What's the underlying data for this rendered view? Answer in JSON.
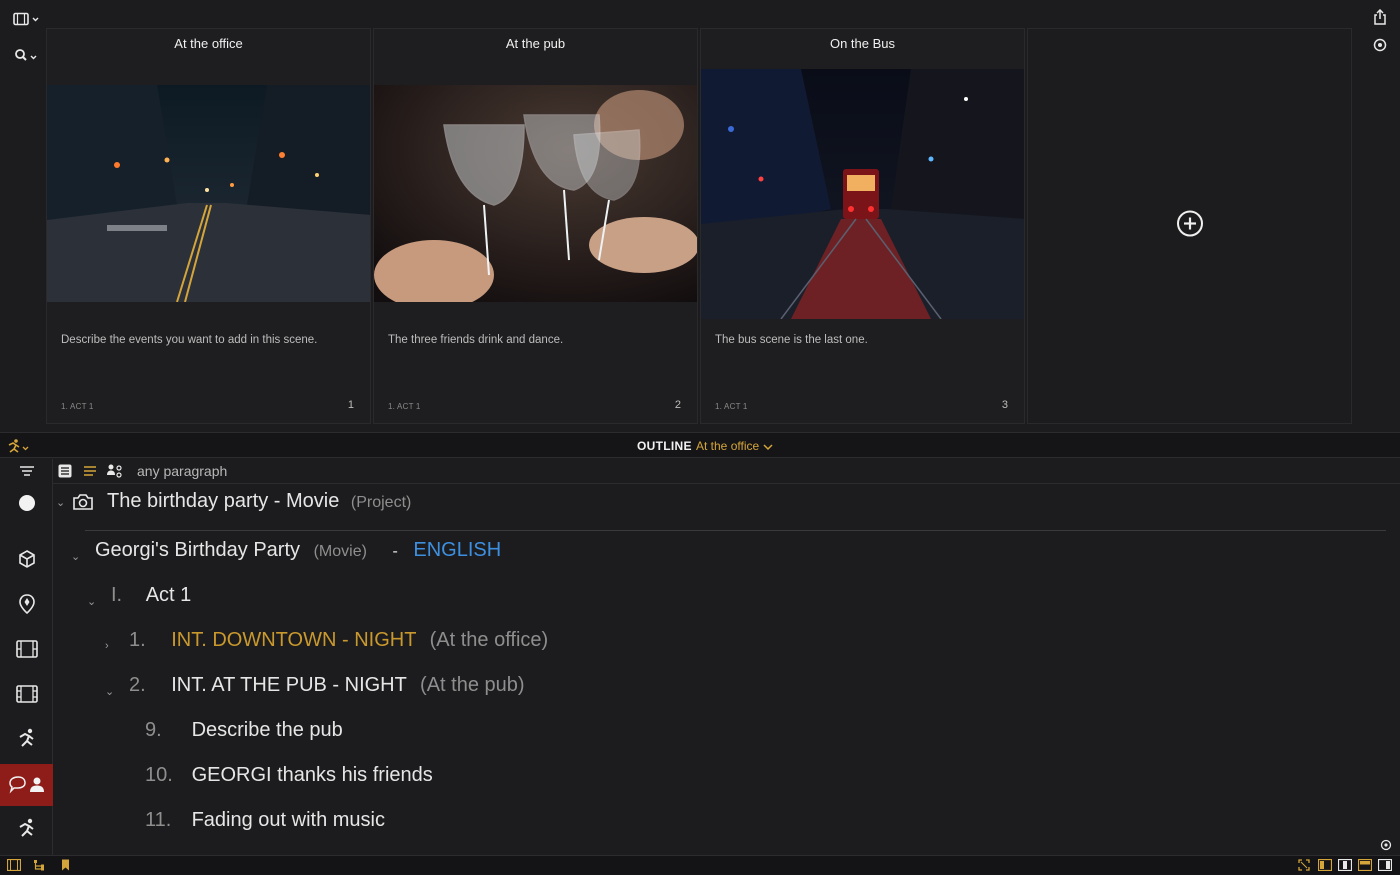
{
  "scenes": [
    {
      "title": "At the office",
      "description": "Describe the events you want to add in this scene.",
      "act": "1. ACT 1",
      "number": "1"
    },
    {
      "title": "At the pub",
      "description": "The three friends drink and dance.",
      "act": "1. ACT 1",
      "number": "2"
    },
    {
      "title": "On the Bus",
      "description": "The bus scene is the last one.",
      "act": "1. ACT 1",
      "number": "3"
    }
  ],
  "outline_bar": {
    "title": "OUTLINE",
    "current_scene": "At the office"
  },
  "toolbar": {
    "filter": "any paragraph"
  },
  "outline": {
    "project": {
      "name": "The birthday party - Movie",
      "type": "(Project)"
    },
    "movie": {
      "name": "Georgi's Birthday Party",
      "type": "(Movie)",
      "separator": "-",
      "language": "ENGLISH"
    },
    "act": {
      "number": "I.",
      "name": "Act 1"
    },
    "scene1": {
      "number": "1.",
      "heading": "INT.  DOWNTOWN - NIGHT",
      "alias": "(At the office)"
    },
    "scene2": {
      "number": "2.",
      "heading": "INT.  AT THE PUB - NIGHT",
      "alias": "(At the pub)"
    },
    "paragraphs": [
      {
        "number": "9.",
        "text": "Describe the pub"
      },
      {
        "number": "10.",
        "text": "GEORGI thanks his friends"
      },
      {
        "number": "11.",
        "text": "Fading out with music"
      }
    ]
  },
  "colors": {
    "accent": "#d4a53a",
    "scene_highlight": "#c9992d",
    "language": "#3d8fe0",
    "active_tab": "#8e1d1a"
  },
  "icons": [
    "film-icon",
    "search-icon",
    "share-icon",
    "settings-icon",
    "add-scene-icon",
    "runner-icon",
    "list-icon",
    "text-icon",
    "characters-icon",
    "circle-icon",
    "cube-icon",
    "location-icon",
    "chat-person-icon",
    "tree-icon",
    "bookmark-icon",
    "fullscreen-icon",
    "layout-icons"
  ]
}
